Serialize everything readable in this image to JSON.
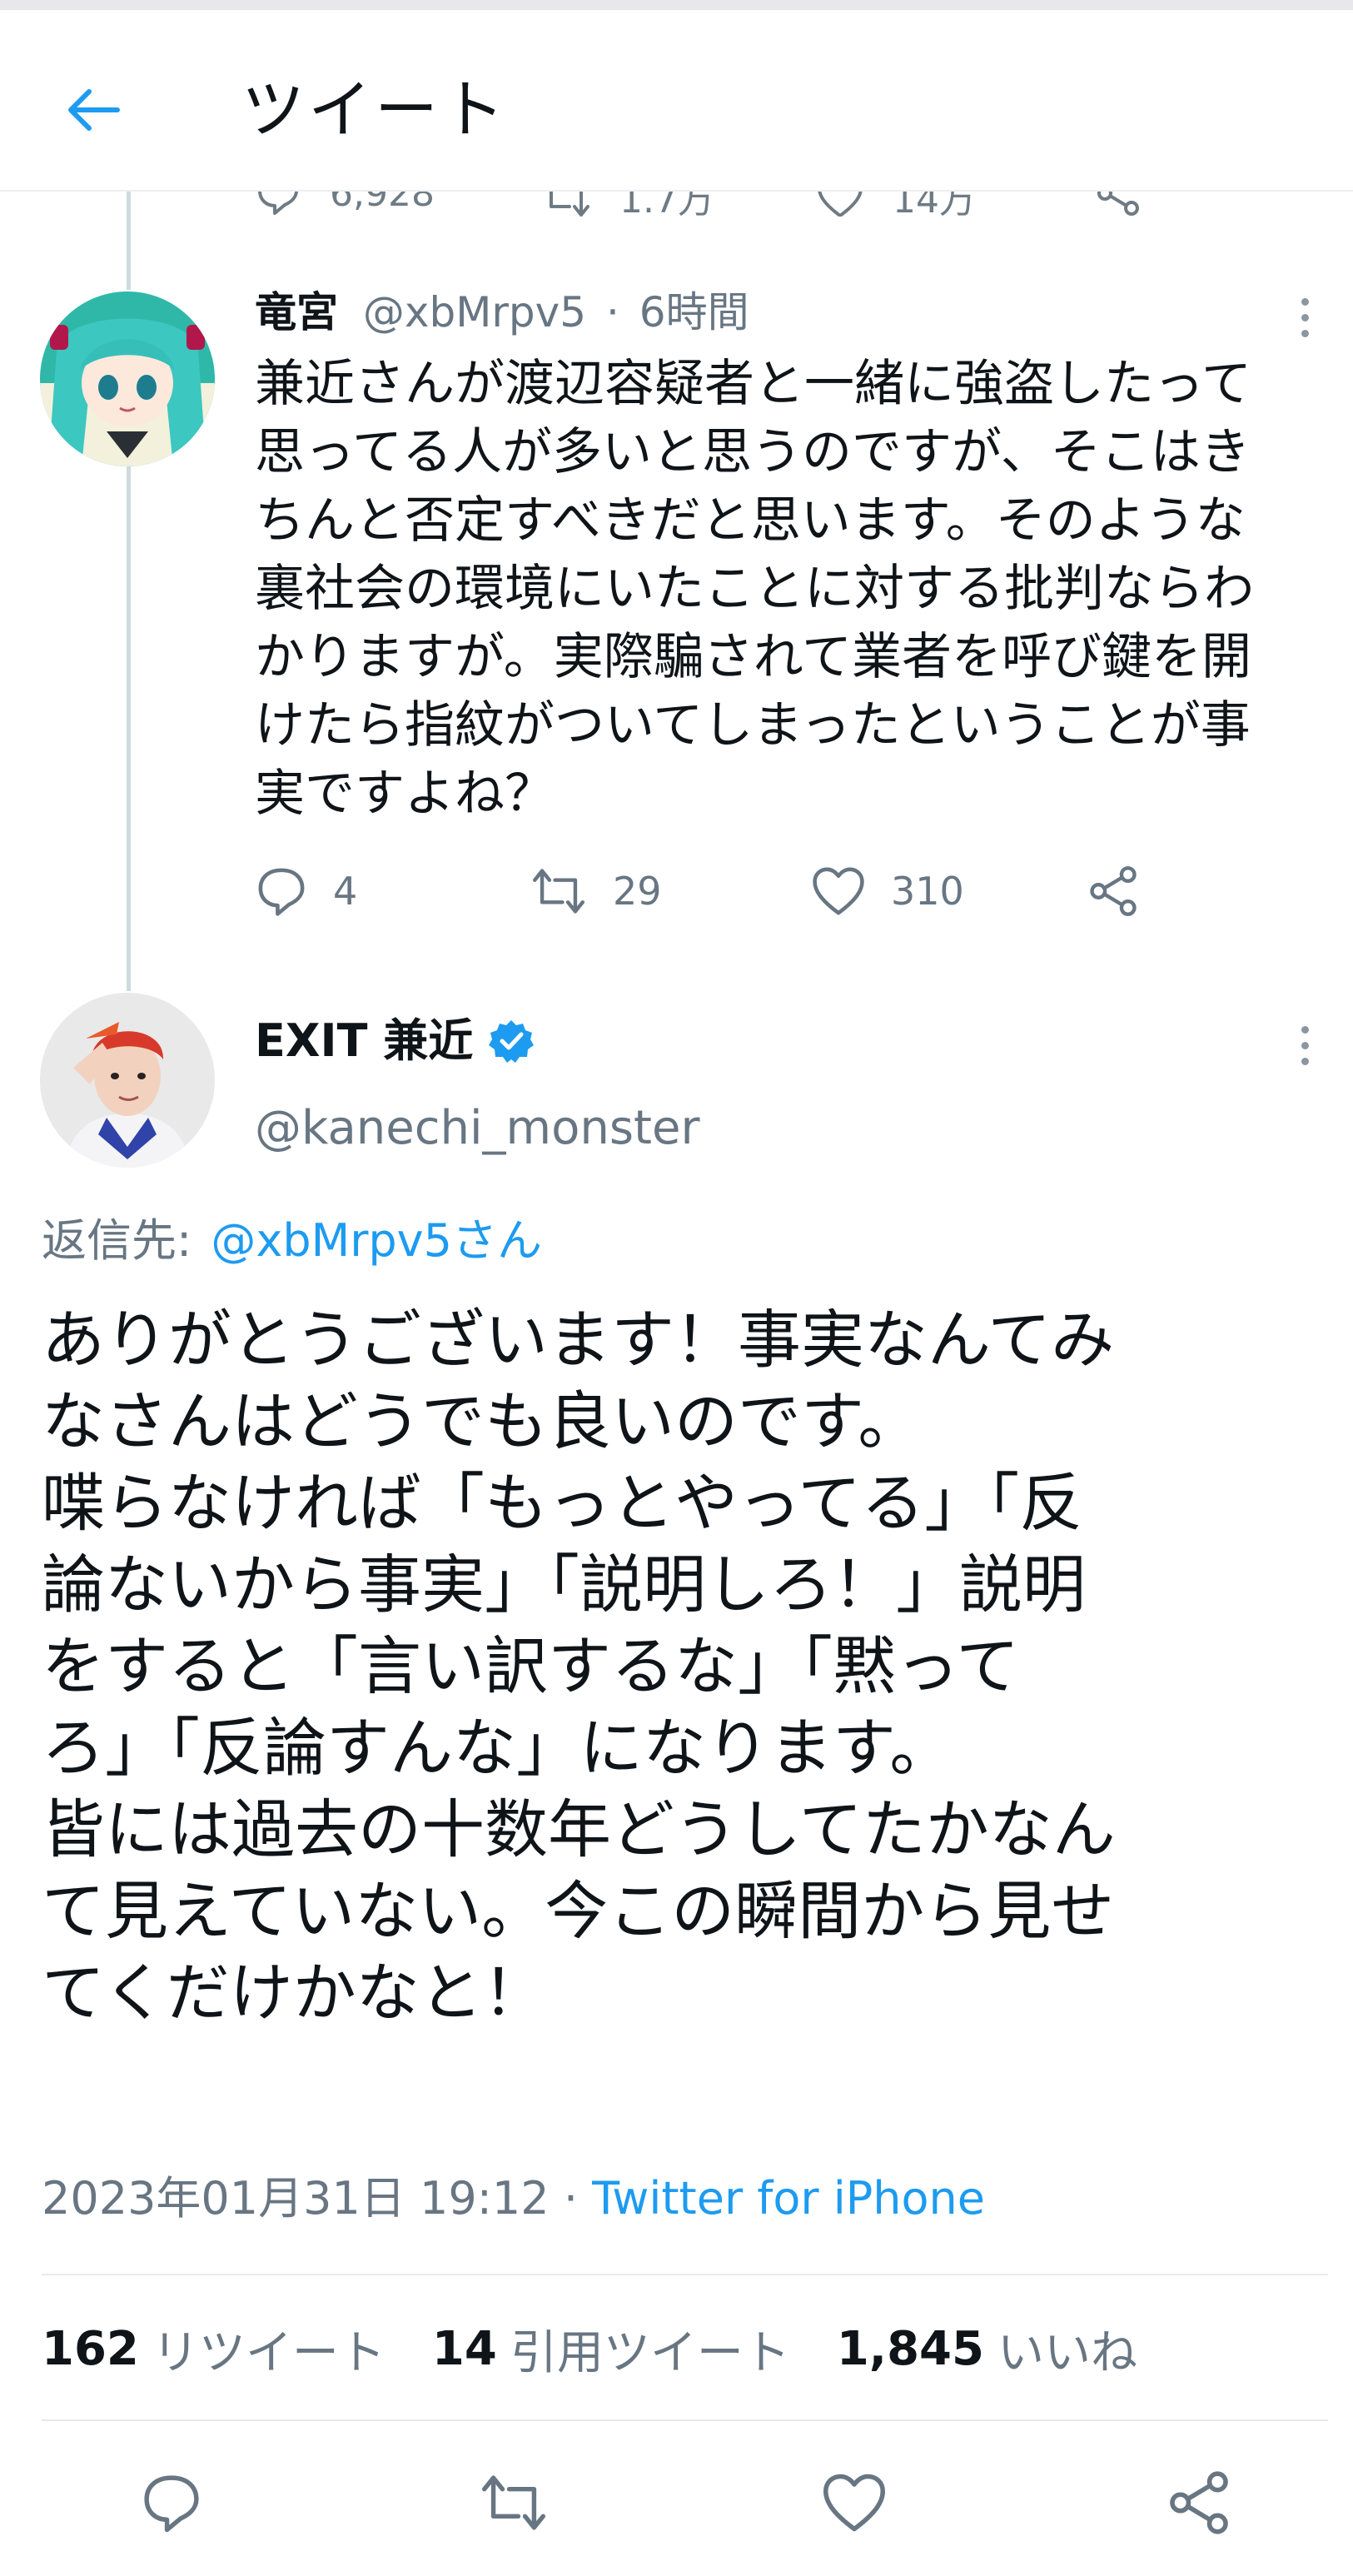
{
  "header": {
    "title": "ツイート"
  },
  "previous_tweet_actions": {
    "replies": "6,928",
    "retweets": "1.7万",
    "likes": "14万"
  },
  "reply_tweet": {
    "display_name": "竜宮",
    "handle": "@xbMrpv5",
    "separator": "·",
    "time": "6時間",
    "text": "兼近さんが渡辺容疑者と一緒に強盗したって\n思ってる人が多いと思うのですが、そこはき\nちんと否定すべきだと思います。そのような\n裏社会の環境にいたことに対する批判ならわ\nかりますが。実際騙されて業者を呼び鍵を開\nけたら指紋がついてしまったということが事\n実ですよね？",
    "replies": "4",
    "retweets": "29",
    "likes": "310"
  },
  "main_tweet": {
    "display_name": "EXIT 兼近",
    "handle": "@kanechi_monster",
    "reply_to_label": "返信先:",
    "reply_to_handle": "@xbMrpv5さん",
    "text": "ありがとうございます！事実なんてみ\nなさんはどうでも良いのです。\n喋らなければ「もっとやってる」「反\n論ないから事実」「説明しろ！」説明\nをすると「言い訳するな」「黙って\nろ」「反論すんな」になります。\n皆には過去の十数年どうしてたかなん\nて見えていない。今この瞬間から見せ\nてくだけかなと！",
    "date": "2023年01月31日 19:12",
    "separator": "·",
    "source": "Twitter for iPhone",
    "retweet_count": "162",
    "retweet_label": "リツイート",
    "quote_count": "14",
    "quote_label": "引用ツイート",
    "like_count": "1,845",
    "like_label": "いいね"
  },
  "colors": {
    "accent": "#1d9bf0",
    "secondary_text": "#687683",
    "text": "#0f1419"
  }
}
